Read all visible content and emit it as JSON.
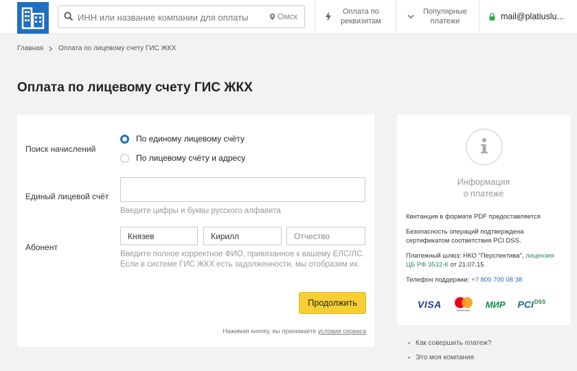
{
  "header": {
    "search_placeholder": "ИНН или название компании для оплаты",
    "city": "Омск",
    "nav_details": [
      "Оплата по",
      "реквизитам"
    ],
    "nav_popular": [
      "Популярные",
      "платежи"
    ],
    "user_email": "mail@platiuslu..."
  },
  "breadcrumb": {
    "home": "Главная",
    "current": "Оплата по лицевому счету ГИС ЖКХ"
  },
  "page_title": "Оплата по лицевому счету ГИС ЖКХ",
  "form": {
    "search_label": "Поиск начислений",
    "radio_1": "По единому лицевому счёту",
    "radio_2": "По лицевому счёту и адресу",
    "account_label": "Единый лицевой счёт",
    "account_value": "",
    "account_hint": "Введите цифры и буквы русского алфавита",
    "subscriber_label": "Абонент",
    "lastname_value": "Князев",
    "firstname_value": "Кирилл",
    "patronymic_placeholder": "Отчество",
    "subscriber_hint_1": "Введите полное корректное ФИО, привязанное к вашему ЕЛС/ЛС.",
    "subscriber_hint_2": "Если в системе ГИС ЖКХ есть задолженности, мы отобразим их.",
    "continue_label": "Продолжить",
    "terms_text": "Нажимая кнопку, вы принимаете",
    "terms_link": "условия сервиса"
  },
  "info": {
    "title_1": "Информация",
    "title_2": "о платеже",
    "receipt": "Квитанция в формате PDF предоставляется",
    "security_1": "Безопасность операций подтверждена",
    "security_2": "сертификатом соответствия PCI DSS.",
    "gateway_a": "Платежный шлюз: НКО \"Перспектива\",",
    "gateway_link_1": "лицензия",
    "gateway_link_2": "ЦБ РФ 3532-К",
    "gateway_b": "от 21.07.15",
    "support_label": "Телефон поддержки:",
    "support_phone": "+7 800 700 08 38",
    "logo_visa": "VISA",
    "logo_mir": "МИР",
    "logo_mastercard": "mastercard",
    "logo_pci": "PCI",
    "logo_dss": "DSS"
  },
  "side_links": [
    "Как совершить платеж?",
    "Это моя компания"
  ],
  "colors": {
    "brand_blue": "#1f6fc2",
    "button_yellow": "#f6cf35",
    "lock_green": "#2ea84b"
  }
}
